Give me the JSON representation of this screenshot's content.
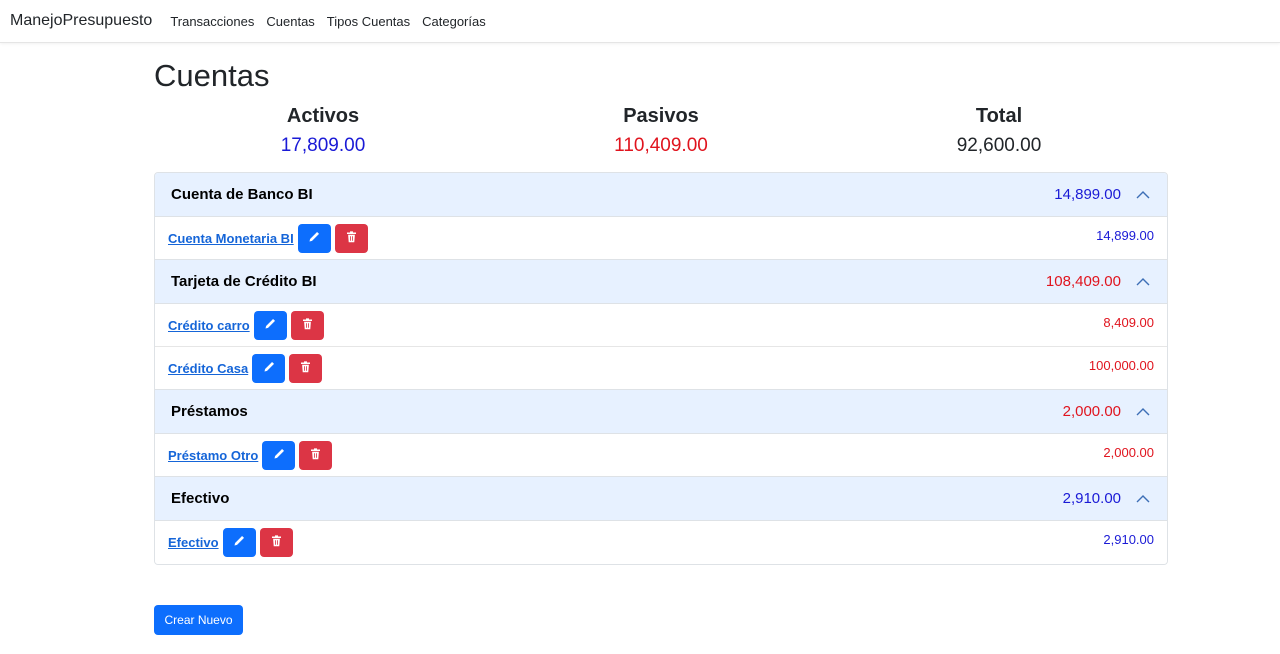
{
  "nav": {
    "brand": "ManejoPresupuesto",
    "links": [
      "Transacciones",
      "Cuentas",
      "Tipos Cuentas",
      "Categorías"
    ]
  },
  "page_title": "Cuentas",
  "summary": {
    "activos_label": "Activos",
    "activos_value": "17,809.00",
    "pasivos_label": "Pasivos",
    "pasivos_value": "110,409.00",
    "total_label": "Total",
    "total_value": "92,600.00"
  },
  "colors": {
    "activo": "#1a1ad6",
    "pasivo": "#e0141e",
    "primary": "#0d6efd",
    "danger": "#dc3545",
    "accordion_header_bg": "#e7f1ff"
  },
  "groups": [
    {
      "title": "Cuenta de Banco BI",
      "total": "14,899.00",
      "accounts": [
        {
          "name": "Cuenta Monetaria BI",
          "amount": "14,899.00"
        }
      ]
    },
    {
      "title": "Tarjeta de Crédito BI",
      "total": "108,409.00",
      "accounts": [
        {
          "name": "Crédito carro",
          "amount": "8,409.00"
        },
        {
          "name": "Crédito Casa",
          "amount": "100,000.00"
        }
      ]
    },
    {
      "title": "Préstamos",
      "total": "2,000.00",
      "accounts": [
        {
          "name": "Préstamo Otro",
          "amount": "2,000.00"
        }
      ]
    },
    {
      "title": "Efectivo",
      "total": "2,910.00",
      "accounts": [
        {
          "name": "Efectivo",
          "amount": "2,910.00"
        }
      ]
    }
  ],
  "icons": {
    "edit": "pencil-icon",
    "delete": "trash-icon",
    "collapse": "chevron-up-icon"
  },
  "create_button": "Crear Nuevo"
}
